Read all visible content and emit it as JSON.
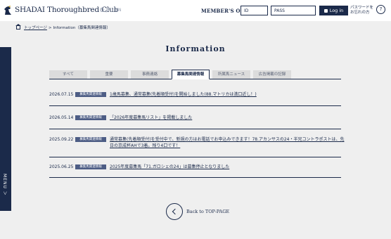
{
  "header": {
    "brand": "SHADAI Thoroughbred Club",
    "lang_jp": "JP",
    "lang_sep": "/",
    "lang_en": "EN",
    "members_label": "MEMBER'S ONLY",
    "id_placeholder": "ID",
    "pass_placeholder": "PASS",
    "login_label": "Log in",
    "forgot_line1": "パスワードを",
    "forgot_line2": "お忘れの方",
    "help_label": "?"
  },
  "breadcrumb": {
    "top_label": "トップページ",
    "separator": ">",
    "current": "Information（募集馬関連情報）"
  },
  "side_menu": {
    "label": "MENU ＞"
  },
  "page_title": "Information",
  "tabs": [
    {
      "label": "すべて",
      "active": false
    },
    {
      "label": "重要",
      "active": false
    },
    {
      "label": "事務連絡",
      "active": false
    },
    {
      "label": "募集馬関連情報",
      "active": true
    },
    {
      "label": "所属馬ニュース",
      "active": false
    },
    {
      "label": "広告掲載の記録",
      "active": false
    }
  ],
  "news": [
    {
      "date": "2026.07.15",
      "badge": "募集馬関連情報",
      "text": "1歳馬募集、通常募集(先着順受付)を開始しました(88.マトリカは満口近し！)"
    },
    {
      "date": "2026.05.14",
      "badge": "募集馬関連情報",
      "text": "「2026年度募集馬リスト」を掲載しました"
    },
    {
      "date": "2025.09.22",
      "badge": "募集馬関連情報",
      "text": "通常募集(先着順受付)を受付中で、新規の方はお電話でお申込みできます！78.アカンサスの24・半兄コントラポストは、先日の京成杯AHで3着。残り4口です！"
    },
    {
      "date": "2025.06.25",
      "badge": "募集馬関連情報",
      "text": "2025年度募集馬「71.ガロシェの24」は募集停止となりました"
    }
  ],
  "back_label": "Back to TOP-PAGE",
  "colors": {
    "navy": "#1b2a4a",
    "badge": "#4d5d85",
    "background": "#efefef"
  }
}
